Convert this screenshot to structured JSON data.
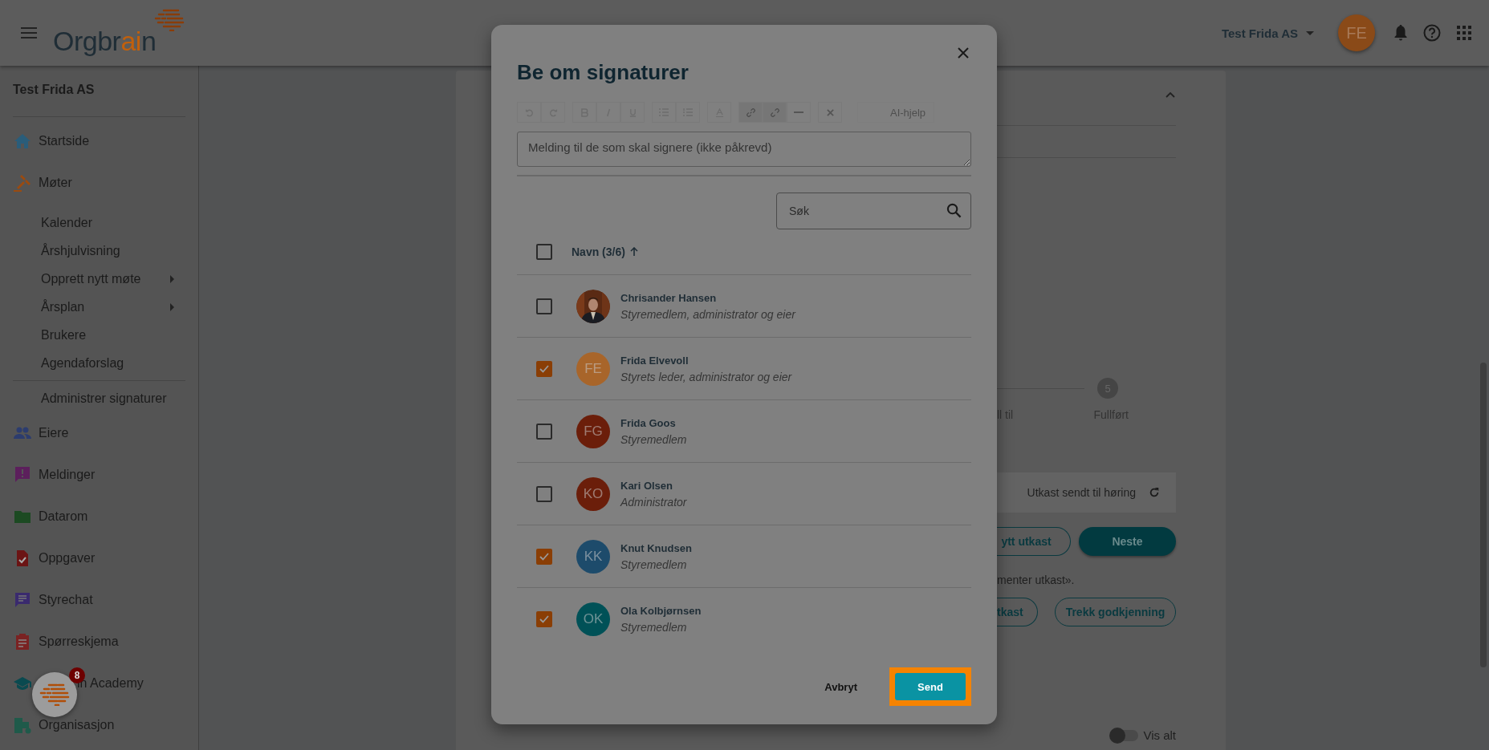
{
  "header": {
    "logo": [
      {
        "text": "Orgbr",
        "accent": false
      },
      {
        "text": "ai",
        "accent": true
      },
      {
        "text": "n",
        "accent": false
      }
    ],
    "org_menu": "Test Frida AS",
    "avatar": "FE"
  },
  "sidebar": {
    "org": "Test Frida AS",
    "groups": [
      [
        {
          "label": "Startside",
          "kind": "main",
          "has_submenu": false
        },
        {
          "label": "Møter",
          "kind": "main",
          "has_submenu": false
        },
        {
          "label": "Kalender",
          "kind": "sub",
          "has_submenu": false
        },
        {
          "label": "Årshjulvisning",
          "kind": "sub",
          "has_submenu": false
        },
        {
          "label": "Opprett nytt møte",
          "kind": "sub",
          "has_submenu": true
        },
        {
          "label": "Årsplan",
          "kind": "sub",
          "has_submenu": true
        },
        {
          "label": "Brukere",
          "kind": "sub",
          "has_submenu": false
        },
        {
          "label": "Agendaforslag",
          "kind": "sub",
          "has_submenu": false
        }
      ],
      [
        {
          "label": "Administrer signaturer",
          "kind": "sub",
          "has_submenu": false
        },
        {
          "label": "Eiere",
          "kind": "main",
          "has_submenu": false
        },
        {
          "label": "Meldinger",
          "kind": "main",
          "has_submenu": false
        },
        {
          "label": "Datarom",
          "kind": "main",
          "has_submenu": false
        },
        {
          "label": "Oppgaver",
          "kind": "main",
          "has_submenu": false
        },
        {
          "label": "Styrechat",
          "kind": "main",
          "has_submenu": false
        },
        {
          "label": "Spørreskjema",
          "kind": "main",
          "has_submenu": false
        },
        {
          "label": "in Academy",
          "kind": "partly_hidden",
          "has_submenu": false
        },
        {
          "label": "Organisasjon",
          "kind": "main",
          "has_submenu": false
        }
      ]
    ]
  },
  "chat_bubble": {
    "badge": "8"
  },
  "background": {
    "stepper": {
      "partial_label": "ll til",
      "step_number": "5",
      "step_label": "Fullført"
    },
    "status": "Utkast sendt til høring",
    "buttons": [
      {
        "label": "ytt utkast",
        "kind": "outlined"
      },
      {
        "label": "Neste",
        "kind": "filled"
      }
    ],
    "note": "menter utkast».",
    "buttons_2": [
      {
        "label": "tkast",
        "kind": "outlined"
      },
      {
        "label": "Trekk godkjenning",
        "kind": "outlined"
      }
    ],
    "toggle": {
      "label": "Vis alt",
      "on": false
    }
  },
  "dialog": {
    "title": "Be om signaturer",
    "ai_help": "AI-hjelp",
    "message_placeholder": "Melding til de som skal signere (ikke påkrevd)",
    "search_placeholder": "Søk",
    "column_header": "Navn (3/6)",
    "all_checked": false,
    "rows": [
      {
        "name": "Chrisander Hansen",
        "role": "Styremedlem, administrator og eier",
        "checked": false
      },
      {
        "name": "Frida Elvevoll",
        "role": "Styrets leder, administrator og eier",
        "kind": "initials",
        "initials": "FE",
        "color": "#a8652a",
        "checked": true
      },
      {
        "name": "Frida Goos",
        "role": "Styremedlem",
        "kind": "initials",
        "initials": "FG",
        "color": "#6b1e0a",
        "checked": false
      },
      {
        "name": "Kari Olsen",
        "role": "Administrator",
        "kind": "initials",
        "initials": "KO",
        "color": "#6b1e0a",
        "checked": false
      },
      {
        "name": "Knut Knudsen",
        "role": "Styremedlem",
        "kind": "initials",
        "initials": "KK",
        "color": "#1d4b6b",
        "checked": true
      },
      {
        "name": "Ola Kolbjørnsen",
        "role": "Styremedlem",
        "kind": "initials",
        "initials": "OK",
        "color": "#005157",
        "checked": true
      }
    ],
    "cancel": "Avbryt",
    "send": "Send",
    "send_highlighted": true
  }
}
